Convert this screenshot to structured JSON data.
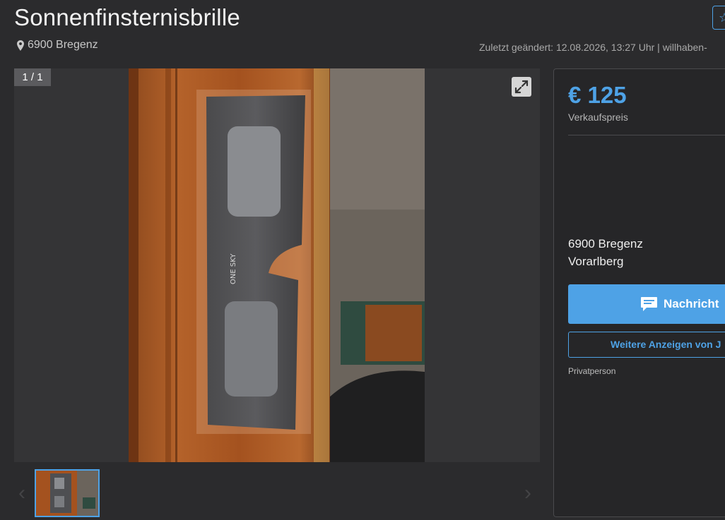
{
  "listing": {
    "title": "Sonnenfinsternisbrille",
    "location": "6900 Bregenz",
    "last_changed": "Zuletzt geändert: 12.08.2026, 13:27 Uhr | willhaben-",
    "star_icon": "star-outline-icon"
  },
  "gallery": {
    "counter": "1 / 1",
    "expand_icon": "expand-arrows-icon",
    "photo_description_icon": "solar-eclipse-glasses-photo",
    "product_print": "ONE SKY"
  },
  "panel": {
    "price": "€ 125",
    "price_label": "Verkaufspreis",
    "address_line1": "6900 Bregenz",
    "address_line2": "Vorarlberg",
    "message_button": "Nachricht",
    "more_ads_button": "Weitere Anzeigen von J",
    "seller_type": "Privatperson"
  },
  "colors": {
    "accent": "#4ea2e6",
    "background": "#2b2b2d",
    "panel_bg": "#262628"
  }
}
